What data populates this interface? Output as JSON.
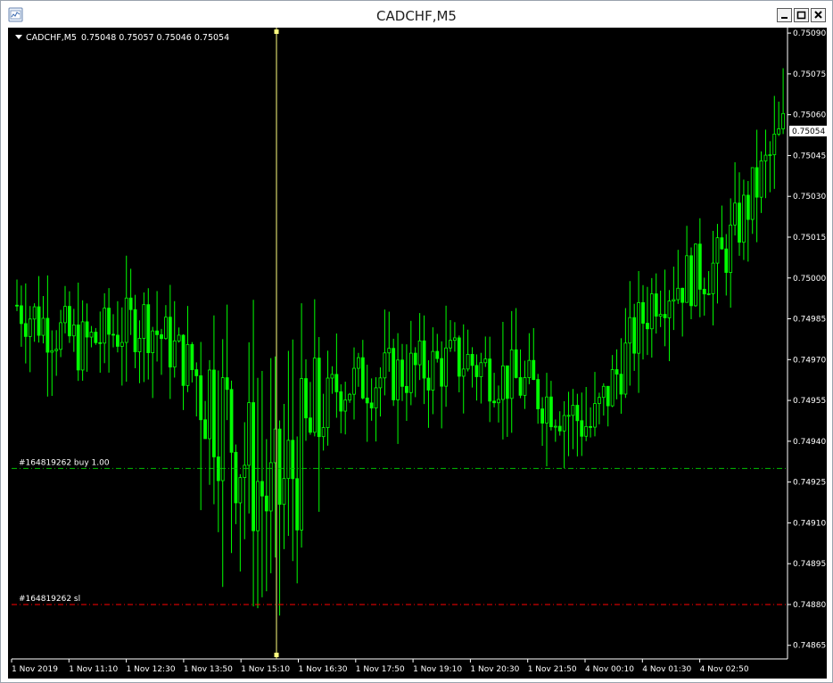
{
  "window": {
    "title": "CADCHF,M5",
    "controls": [
      "minimize",
      "maximize",
      "close"
    ]
  },
  "info_bar": {
    "symbol": "CADCHF,M5",
    "open": "0.75048",
    "high": "0.75057",
    "low": "0.75046",
    "close": "0.75054"
  },
  "colors": {
    "background": "#000000",
    "candle": "#00ff00",
    "buy_line": "#00c000",
    "sl_line": "#ff0000",
    "crosshair": "#ffff80",
    "axis": "#ffffff"
  },
  "price_axis": {
    "labels": [
      "0.75090",
      "0.75075",
      "0.75060",
      "0.75045",
      "0.75030",
      "0.75015",
      "0.75000",
      "0.74985",
      "0.74970",
      "0.74955",
      "0.74940",
      "0.74925",
      "0.74910",
      "0.74895",
      "0.74880",
      "0.74865"
    ],
    "current_price": "0.75054"
  },
  "time_axis": {
    "labels": [
      "1 Nov 2019",
      "1 Nov 11:10",
      "1 Nov 12:30",
      "1 Nov 13:50",
      "1 Nov 15:10",
      "1 Nov 16:30",
      "1 Nov 17:50",
      "1 Nov 19:10",
      "1 Nov 20:30",
      "1 Nov 21:50",
      "4 Nov 00:10",
      "4 Nov 01:30",
      "4 Nov 02:50"
    ]
  },
  "orders": [
    {
      "label": "#164819262 buy 1.00",
      "price": 0.7493,
      "type": "buy"
    },
    {
      "label": "#164819262 sl",
      "price": 0.7488,
      "type": "sl"
    }
  ],
  "chart_data": {
    "type": "line",
    "symbol": "CADCHF",
    "timeframe": "M5",
    "ylim": [
      0.7486,
      0.75092
    ],
    "x": [
      "1 Nov 2019",
      "1 Nov 11:10",
      "1 Nov 12:30",
      "1 Nov 13:50",
      "1 Nov 15:10",
      "1 Nov 16:30",
      "1 Nov 17:50",
      "1 Nov 19:10",
      "1 Nov 20:30",
      "1 Nov 21:50",
      "4 Nov 00:10",
      "4 Nov 01:30",
      "4 Nov 02:50"
    ],
    "series": [
      {
        "values": [
          0.7499,
          0.74975,
          0.74985,
          0.7496,
          0.74915,
          0.7496,
          0.74965,
          0.7497,
          0.7496,
          0.74945,
          0.74995,
          0.75005,
          0.75054
        ]
      }
    ]
  }
}
